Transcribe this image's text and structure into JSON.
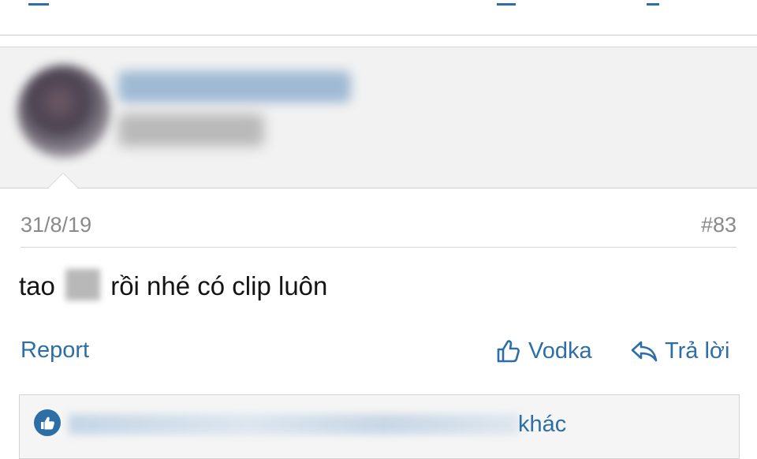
{
  "post": {
    "date": "31/8/19",
    "number": "#83",
    "body_before": "tao",
    "body_after": "rồi nhé có clip luôn"
  },
  "actions": {
    "report": "Report",
    "like": "Vodka",
    "reply": "Trả lời"
  },
  "likes": {
    "suffix": "khác"
  },
  "colors": {
    "link": "#2d6ea6",
    "meta_text": "#8a8a8a",
    "user_block_bg": "#f2f2f2"
  },
  "icons": {
    "like": "thumbs-up-icon",
    "reply": "reply-arrow-icon",
    "likes_badge": "thumbs-up-badge-icon"
  }
}
